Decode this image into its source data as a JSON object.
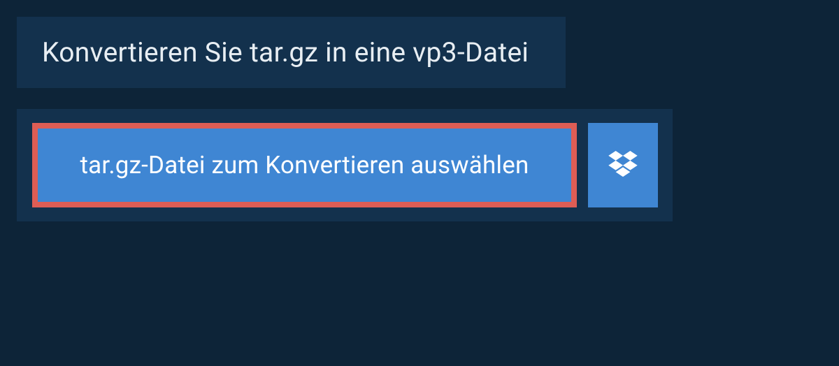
{
  "header": {
    "title": "Konvertieren Sie tar.gz in eine vp3-Datei"
  },
  "upload": {
    "choose_label": "tar.gz-Datei zum Konvertieren auswählen"
  },
  "colors": {
    "background": "#0d2438",
    "panel": "#13314d",
    "button": "#3f86d3",
    "highlight_border": "#de5d55",
    "text_light": "#e8eef3"
  }
}
